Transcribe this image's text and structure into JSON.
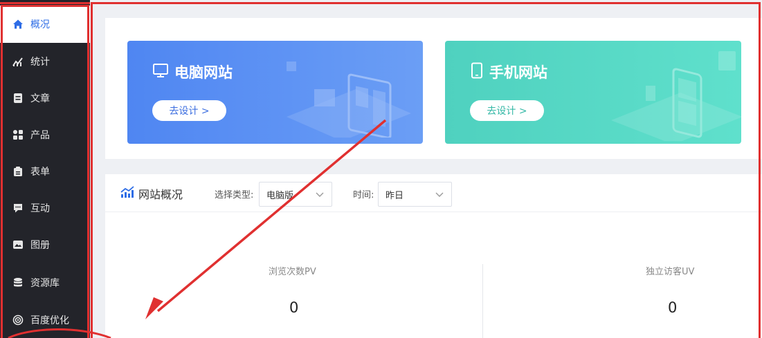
{
  "sidebar": {
    "items": [
      {
        "label": "概况",
        "icon": "home-icon"
      },
      {
        "label": "统计",
        "icon": "chart-icon"
      },
      {
        "label": "文章",
        "icon": "document-icon"
      },
      {
        "label": "产品",
        "icon": "grid-icon"
      },
      {
        "label": "表单",
        "icon": "clipboard-icon"
      },
      {
        "label": "互动",
        "icon": "chat-icon"
      },
      {
        "label": "图册",
        "icon": "image-icon"
      },
      {
        "label": "资源库",
        "icon": "database-icon"
      },
      {
        "label": "百度优化",
        "icon": "target-icon"
      }
    ]
  },
  "banners": {
    "pc": {
      "title": "电脑网站",
      "button": "去设计 >",
      "icon": "monitor-icon"
    },
    "mobile": {
      "title": "手机网站",
      "button": "去设计 >",
      "icon": "phone-icon"
    }
  },
  "overview": {
    "title": "网站概况",
    "type_label": "选择类型:",
    "type_value": "电脑版",
    "time_label": "时间:",
    "time_value": "昨日",
    "metrics": [
      {
        "label": "浏览次数PV",
        "value": "0"
      },
      {
        "label": "独立访客UV",
        "value": "0"
      }
    ]
  },
  "colors": {
    "sidebar_bg": "#23242a",
    "accent": "#2e6de6",
    "pc_banner": "#5b8ff3",
    "mobile_banner": "#55d8c5",
    "annotation": "#e03030"
  }
}
